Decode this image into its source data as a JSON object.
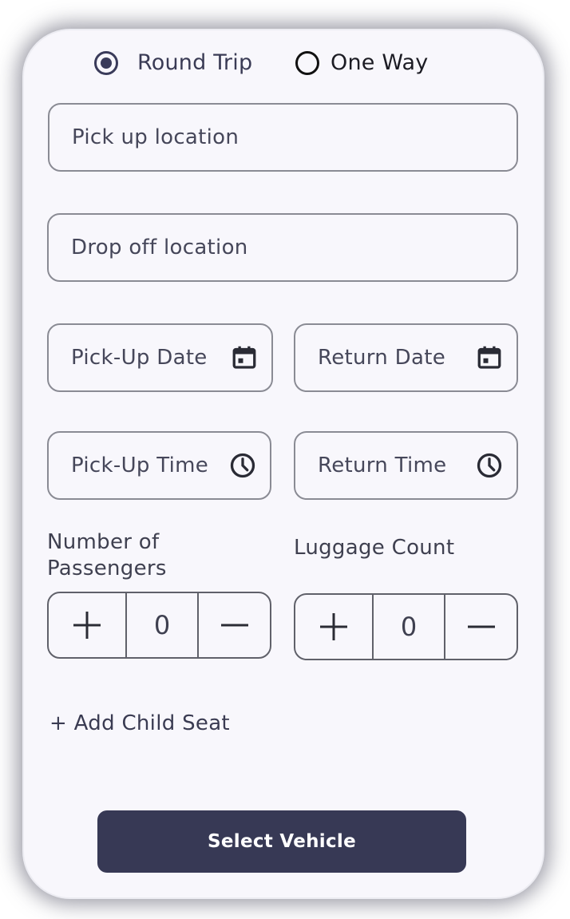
{
  "trip_type": {
    "options": [
      {
        "label": "Round Trip",
        "selected": true
      },
      {
        "label": "One Way",
        "selected": false
      }
    ]
  },
  "fields": {
    "pickup_location": {
      "placeholder": "Pick up location"
    },
    "dropoff_location": {
      "placeholder": "Drop off location"
    },
    "pickup_date": {
      "placeholder": "Pick-Up Date",
      "icon": "calendar-icon"
    },
    "return_date": {
      "placeholder": "Return Date",
      "icon": "calendar-icon"
    },
    "pickup_time": {
      "placeholder": "Pick-Up Time",
      "icon": "clock-icon"
    },
    "return_time": {
      "placeholder": "Return Time",
      "icon": "clock-icon"
    }
  },
  "passengers": {
    "label_line1": "Number of",
    "label_line2": "Passengers",
    "value": "0",
    "increment_icon": "plus-icon",
    "decrement_icon": "minus-icon"
  },
  "luggage": {
    "label": "Luggage Count",
    "value": "0",
    "increment_icon": "plus-icon",
    "decrement_icon": "minus-icon"
  },
  "add_child_seat": {
    "label": "+ Add Child Seat"
  },
  "select_vehicle": {
    "label": "Select Vehicle"
  },
  "colors": {
    "primary": "#373955",
    "card_background": "#f8f7fc",
    "field_border": "#8a8b94"
  }
}
